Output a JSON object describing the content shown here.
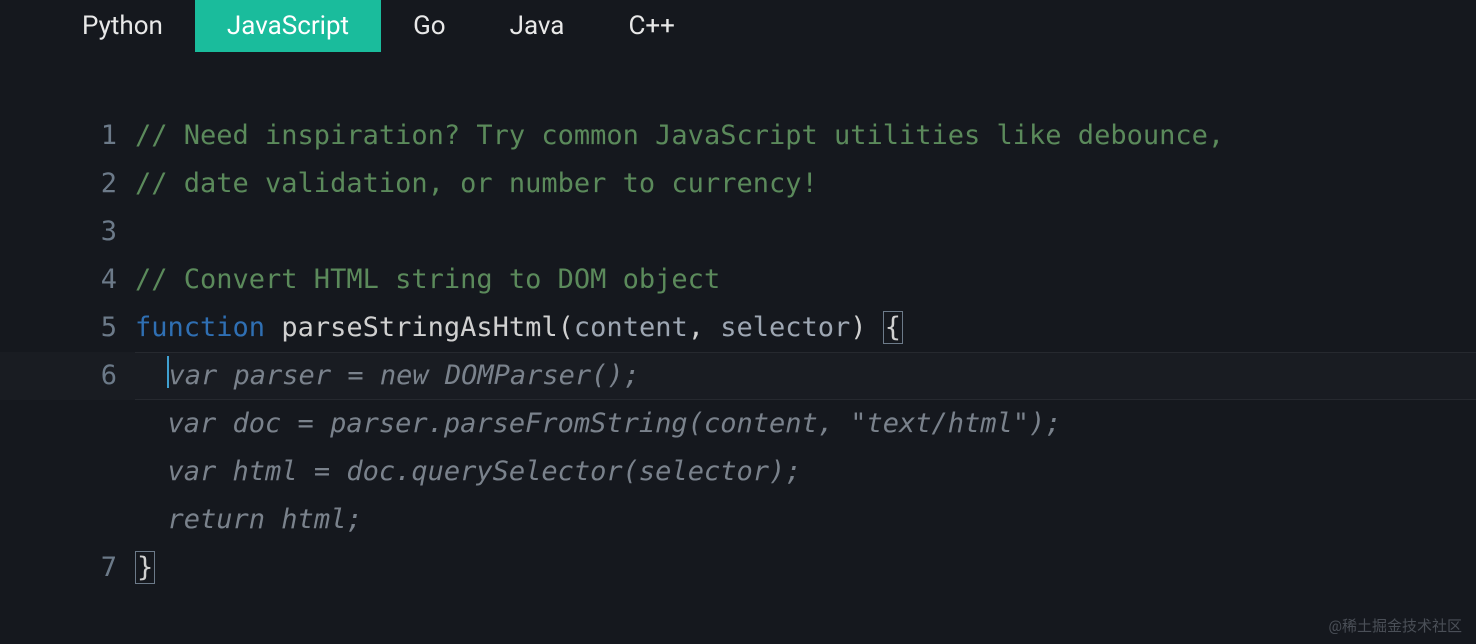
{
  "tabs": {
    "items": [
      {
        "label": "Python",
        "active": false
      },
      {
        "label": "JavaScript",
        "active": true
      },
      {
        "label": "Go",
        "active": false
      },
      {
        "label": "Java",
        "active": false
      },
      {
        "label": "C++",
        "active": false
      }
    ]
  },
  "editor": {
    "active_line": 6,
    "lines": [
      {
        "n": 1,
        "tokens": [
          {
            "cls": "comment",
            "text": "// Need inspiration? Try common JavaScript utilities like debounce,"
          }
        ]
      },
      {
        "n": 2,
        "tokens": [
          {
            "cls": "comment",
            "text": "// date validation, or number to currency!"
          }
        ]
      },
      {
        "n": 3,
        "tokens": [
          {
            "cls": "",
            "text": ""
          }
        ]
      },
      {
        "n": 4,
        "tokens": [
          {
            "cls": "comment",
            "text": "// Convert HTML string to DOM object"
          }
        ]
      },
      {
        "n": 5,
        "tokens": [
          {
            "cls": "keyword",
            "text": "function"
          },
          {
            "cls": "",
            "text": " "
          },
          {
            "cls": "fn-name",
            "text": "parseStringAsHtml"
          },
          {
            "cls": "punct",
            "text": "("
          },
          {
            "cls": "param",
            "text": "content"
          },
          {
            "cls": "punct",
            "text": ", "
          },
          {
            "cls": "param",
            "text": "selector"
          },
          {
            "cls": "punct",
            "text": ") "
          },
          {
            "cls": "bracket-box",
            "text": "{"
          }
        ]
      },
      {
        "n": 6,
        "current": true,
        "indent": "  ",
        "cursor": true,
        "suggestion": "var parser = new DOMParser();"
      },
      {
        "n": null,
        "indent": "  ",
        "suggestion": "var doc = parser.parseFromString(content, \"text/html\");"
      },
      {
        "n": null,
        "indent": "  ",
        "suggestion": "var html = doc.querySelector(selector);"
      },
      {
        "n": null,
        "indent": "  ",
        "suggestion": "return html;"
      },
      {
        "n": 7,
        "tokens": [
          {
            "cls": "bracket-box",
            "text": "}"
          }
        ]
      }
    ]
  },
  "watermark": "@稀土掘金技术社区"
}
